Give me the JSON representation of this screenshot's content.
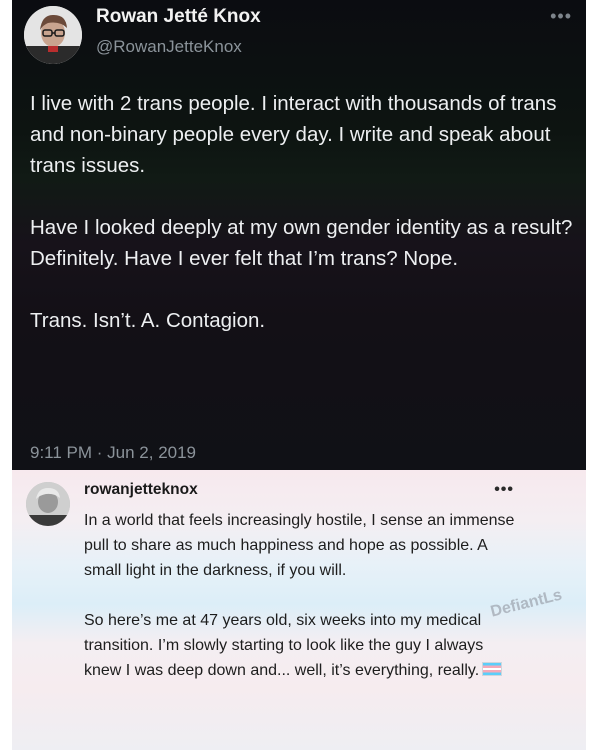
{
  "tweet": {
    "display_name": "Rowan Jetté Knox",
    "handle": "@RowanJetteKnox",
    "more_icon": "ellipsis-icon",
    "paragraphs": [
      "I live with 2 trans people. I interact with thousands of trans and non-binary people every day. I write and speak about trans issues.",
      "Have I looked deeply at my own gender identity as a result? Definitely. Have I ever felt that I’m trans? Nope.",
      "Trans. Isn’t. A. Contagion."
    ],
    "timestamp": "9:11 PM · Jun 2, 2019"
  },
  "post": {
    "username": "rowanjetteknox",
    "more_icon": "ellipsis-icon",
    "paragraphs": [
      "In a world that feels increasingly hostile, I sense an immense pull to share as much happiness and hope as possible. A small light in the darkness, if you will.",
      "So here’s me at 47 years old, six weeks into my medical transition. I’m slowly starting to look like the guy I always knew I was deep down and... well, it’s everything, really."
    ],
    "flag_icon": "transgender-flag-icon",
    "colors": {
      "flag_blue": "#5bcefa",
      "flag_pink": "#f5a9b8",
      "flag_white": "#ffffff"
    }
  },
  "watermark": "DefiantLs"
}
